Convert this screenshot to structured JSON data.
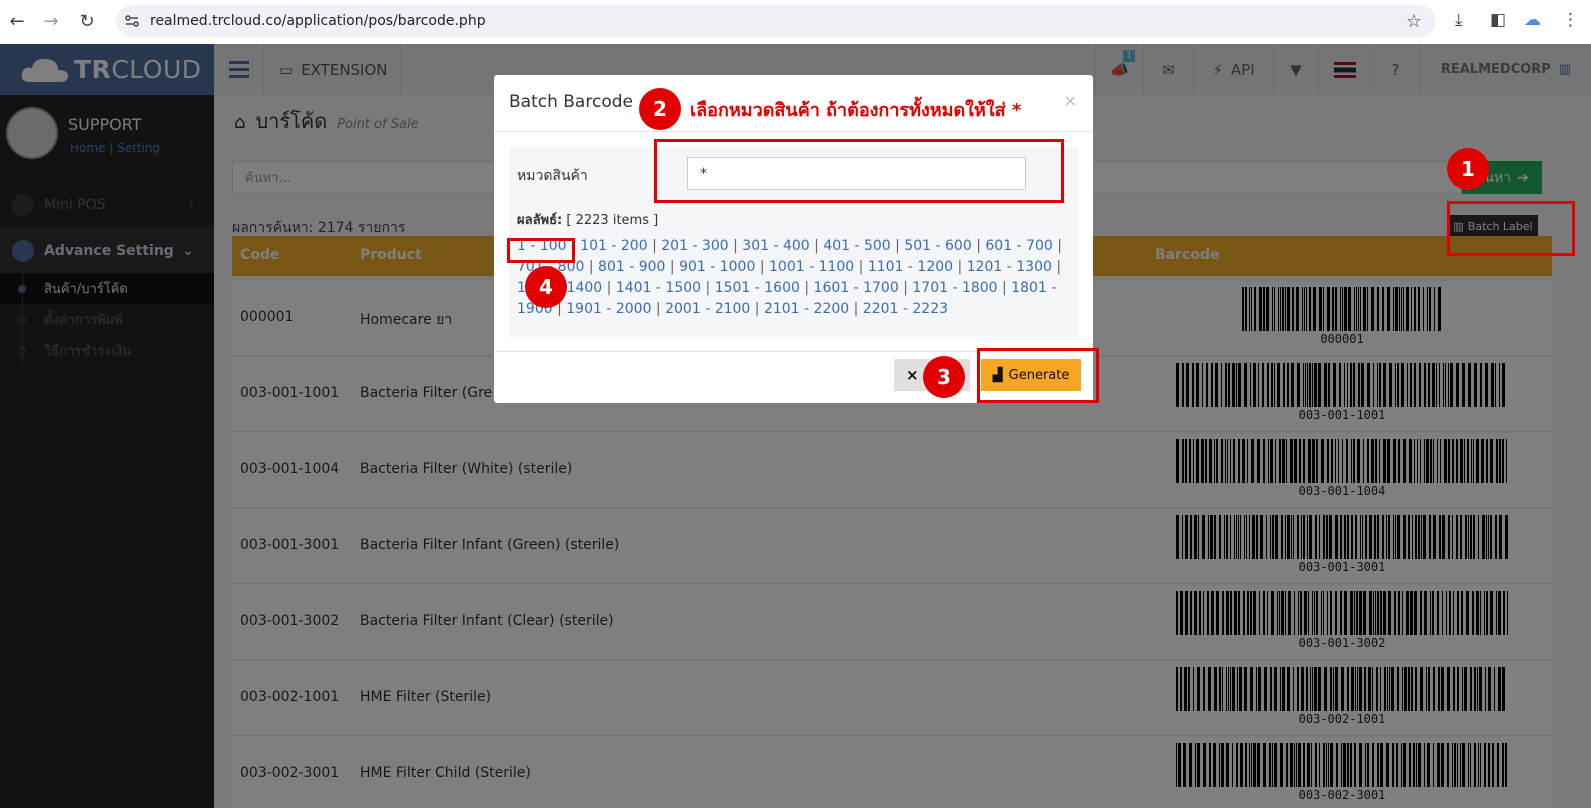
{
  "browser": {
    "url": "realmed.trcloud.co/application/pos/barcode.php"
  },
  "header": {
    "logo_bold": "TR",
    "logo_light": "CLOUD",
    "extension": "EXTENSION",
    "api": "API",
    "company": "REALMEDCORP",
    "notif_count": "1"
  },
  "sidebar": {
    "user": "SUPPORT",
    "home": "Home",
    "setting": "Setting",
    "items": [
      {
        "label": "Mini POS"
      },
      {
        "label": "Advance Setting"
      }
    ],
    "subitems": [
      {
        "label": "สินค้า/บาร์โค้ด"
      },
      {
        "label": "ตั้งค่าการพิมพ์"
      },
      {
        "label": "วิธีการชำระเงิน"
      }
    ]
  },
  "page": {
    "title": "บาร์โค้ด",
    "subtitle": "Point of Sale",
    "search_placeholder": "ค้นหา...",
    "search_btn": "ค้นหา",
    "result_count": "ผลการค้นหา: 2174 รายการ",
    "batch_label_btn": "Batch Label"
  },
  "table": {
    "headers": [
      "Code",
      "Product",
      "Barcode"
    ],
    "rows": [
      {
        "code": "000001",
        "product": "Homecare ยา",
        "barcode": "000001"
      },
      {
        "code": "003-001-1001",
        "product": "Bacteria Filter (Gre",
        "barcode": "003-001-1001"
      },
      {
        "code": "003-001-1004",
        "product": "Bacteria Filter (White) (sterile)",
        "barcode": "003-001-1004"
      },
      {
        "code": "003-001-3001",
        "product": "Bacteria Filter Infant (Green) (sterile)",
        "barcode": "003-001-3001"
      },
      {
        "code": "003-001-3002",
        "product": "Bacteria Filter Infant (Clear) (sterile)",
        "barcode": "003-001-3002"
      },
      {
        "code": "003-002-1001",
        "product": "HME Filter (Sterile)",
        "barcode": "003-002-1001"
      },
      {
        "code": "003-002-3001",
        "product": "HME Filter Child (Sterile)",
        "barcode": "003-002-3001"
      }
    ]
  },
  "modal": {
    "title": "Batch Barcode",
    "close_x": "×",
    "category_label": "หมวดสินค้า",
    "category_value": "*",
    "results_label": "ผลลัพธ์:",
    "results_value": "[ 2223 items ]",
    "ranges": [
      "1 - 100",
      "101 - 200",
      "201 - 300",
      "301 - 400",
      "401 - 500",
      "501 - 600",
      "601 - 700",
      "701 - 800",
      "801 - 900",
      "901 - 1000",
      "1001 - 1100",
      "1101 - 1200",
      "1201 - 1300",
      "1301 - 1400",
      "1401 - 1500",
      "1501 - 1600",
      "1601 - 1700",
      "1701 - 1800",
      "1801 - 1900",
      "1901 - 2000",
      "2001 - 2100",
      "2101 - 2200",
      "2201 - 2223"
    ],
    "close_btn": "×",
    "generate_btn": "Generate"
  },
  "annotations": {
    "step1": "1",
    "step2": "2",
    "step3": "3",
    "step4": "4",
    "instruction": "เลือกหมวดสินค้า ถ้าต้องการทั้งหมดให้ใส่ *",
    "color": "#e00000"
  }
}
